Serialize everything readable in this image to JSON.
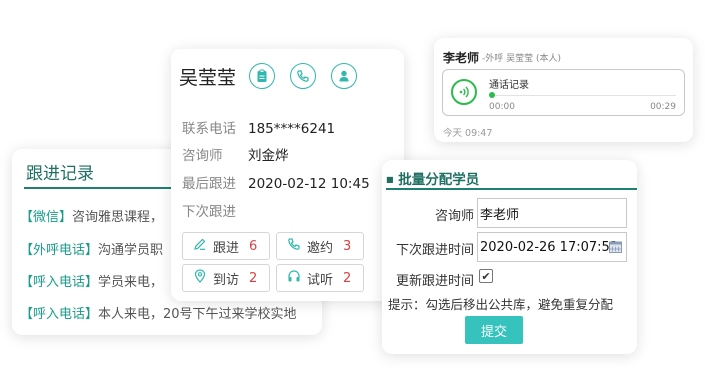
{
  "followup": {
    "title": "跟进记录",
    "entries": [
      {
        "tag": "【微信】",
        "text": "咨询雅思课程，"
      },
      {
        "tag": "【外呼电话】",
        "text": "沟通学员职"
      },
      {
        "tag": "【呼入电话】",
        "text": "学员来电，"
      },
      {
        "tag": "【呼入电话】",
        "text": "本人来电，20号下午过来学校实地"
      }
    ]
  },
  "student": {
    "name": "吴莹莹",
    "fields": [
      {
        "label": "联系电话",
        "value": "185****6241"
      },
      {
        "label": "咨询师",
        "value": "刘金烨"
      },
      {
        "label": "最后跟进",
        "value": "2020-02-12  10:45"
      },
      {
        "label": "下次跟进",
        "value": ""
      }
    ],
    "stats": [
      {
        "label": "跟进",
        "count": "6",
        "icon": "pencil-icon"
      },
      {
        "label": "邀约",
        "count": "3",
        "icon": "phone-icon"
      },
      {
        "label": "到访",
        "count": "2",
        "icon": "location-pin-icon"
      },
      {
        "label": "试听",
        "count": "2",
        "icon": "headphones-icon"
      }
    ]
  },
  "call": {
    "caller": "李老师",
    "meta": "-外呼   吴莹莹 (本人)",
    "title": "通话记录",
    "time_start": "00:00",
    "time_end": "00:29",
    "when": "今天 09:47",
    "progress": 0.0
  },
  "assign": {
    "title": "批量分配学员",
    "consultant_label": "咨询师",
    "consultant_value": "李老师",
    "next_label": "下次跟进时间",
    "next_value": "2020-02-26 17:07:53",
    "update_label": "更新跟进时间",
    "update_checked": "✔",
    "tip": "提示：勾选后移出公共库，避免重复分配",
    "submit": "提交"
  },
  "colors": {
    "accent": "#1f7f70",
    "teal": "#36c3bd",
    "count": "#d94141",
    "play": "#2dbb4e"
  }
}
